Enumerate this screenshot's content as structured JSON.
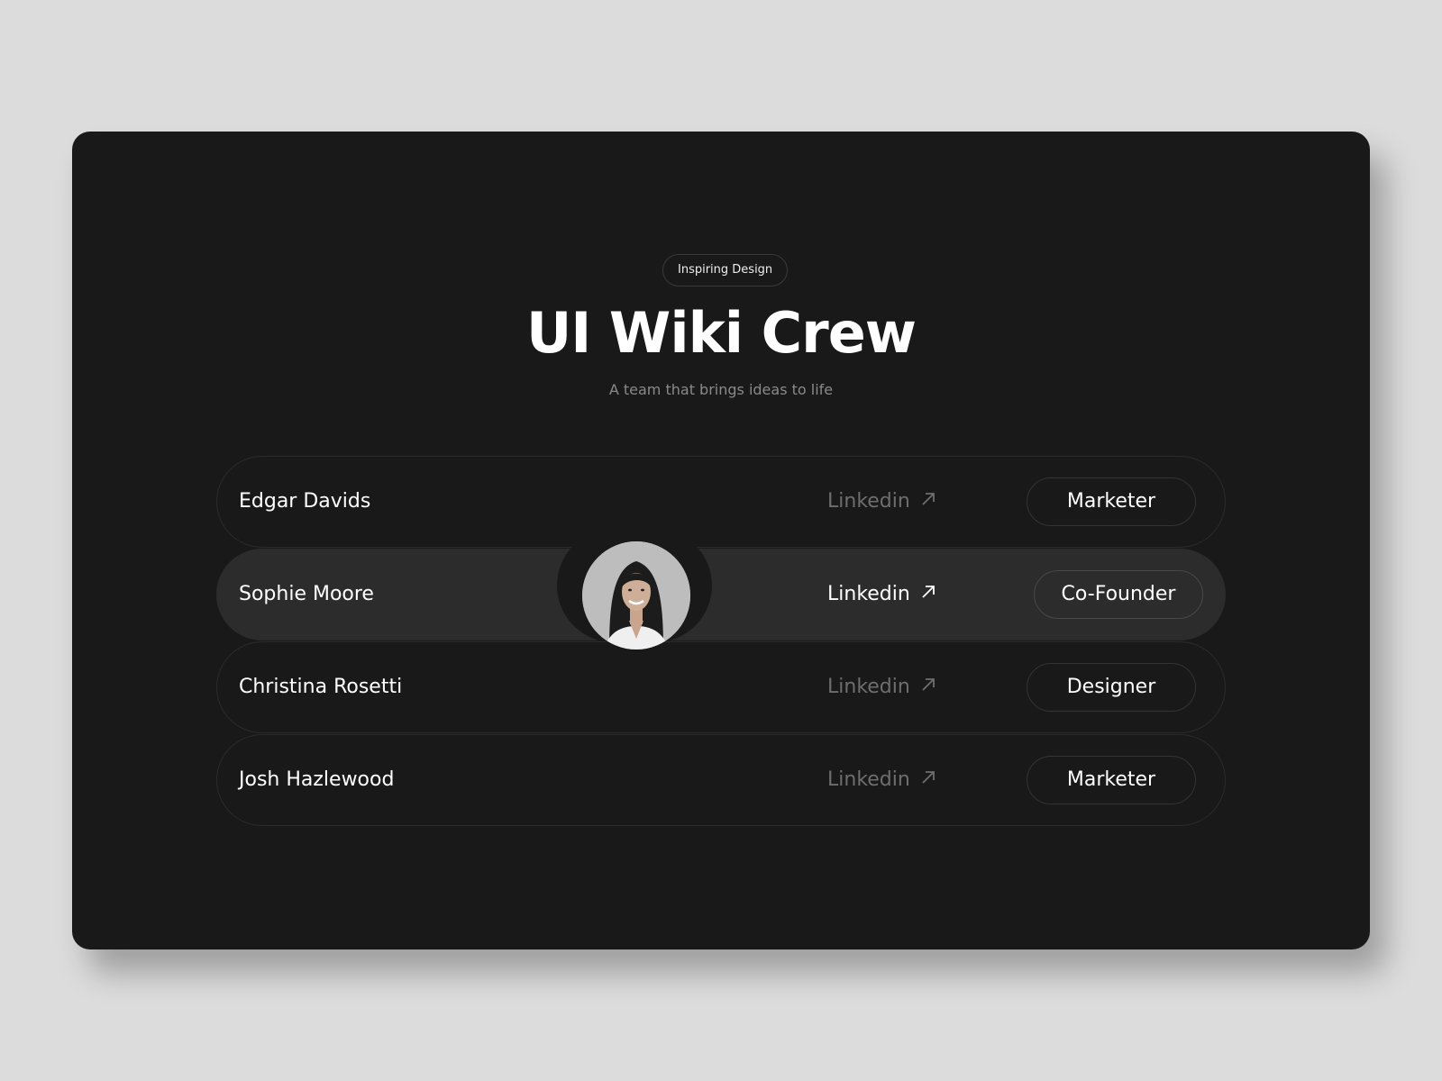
{
  "header": {
    "tag": "Inspiring Design",
    "title": "UI Wiki Crew",
    "subtitle": "A team that brings ideas to life"
  },
  "team": [
    {
      "name": "Edgar Davids",
      "link": "Linkedin",
      "role": "Marketer",
      "active": false
    },
    {
      "name": "Sophie Moore",
      "link": "Linkedin",
      "role": "Co-Founder",
      "active": true
    },
    {
      "name": "Christina Rosetti",
      "link": "Linkedin",
      "role": "Designer",
      "active": false
    },
    {
      "name": "Josh Hazlewood",
      "link": "Linkedin",
      "role": "Marketer",
      "active": false
    }
  ],
  "colors": {
    "page_background": "#dcdcdc",
    "card_background": "#191919",
    "active_row": "#2c2c2c",
    "muted_link": "#6e6e6e",
    "text": "#ffffff"
  },
  "icons": {
    "link_icon": "arrow-up-right-icon"
  }
}
